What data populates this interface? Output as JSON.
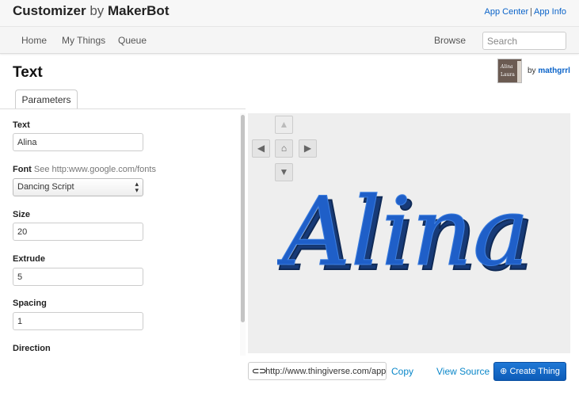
{
  "header": {
    "brand_main": "Customizer",
    "brand_by": "by",
    "brand_company": "MakerBot",
    "links": [
      "App Center",
      "App Info"
    ],
    "link_separator": "|"
  },
  "nav": {
    "items": [
      "Home",
      "My Things",
      "Queue"
    ],
    "browse": "Browse",
    "search_placeholder": "Search"
  },
  "page": {
    "title": "Text",
    "by": "by",
    "author": "mathgrrl",
    "thumb_line1": "Alina",
    "thumb_line2": "Laura"
  },
  "tabs": [
    "Parameters"
  ],
  "form": {
    "text_label": "Text",
    "text_value": "Alina",
    "font_label": "Font",
    "font_hint": "See http:www.google.com/fonts",
    "font_value": "Dancing Script",
    "size_label": "Size",
    "size_value": "20",
    "extrude_label": "Extrude",
    "extrude_value": "5",
    "spacing_label": "Spacing",
    "spacing_value": "1",
    "direction_label": "Direction"
  },
  "viewer": {
    "model_text": "Alina",
    "model_color": "#1f5fc8",
    "model_shadow": "#173a77",
    "background": "#eeeeee",
    "nav_icons": [
      "arrow-up-icon",
      "arrow-left-icon",
      "home-icon",
      "arrow-right-icon",
      "arrow-down-icon"
    ]
  },
  "footer": {
    "url": "http://www.thingiverse.com/apps/customizer/run?thing_id",
    "copy": "Copy",
    "view_source": "View Source",
    "create_thing": "Create Thing"
  }
}
